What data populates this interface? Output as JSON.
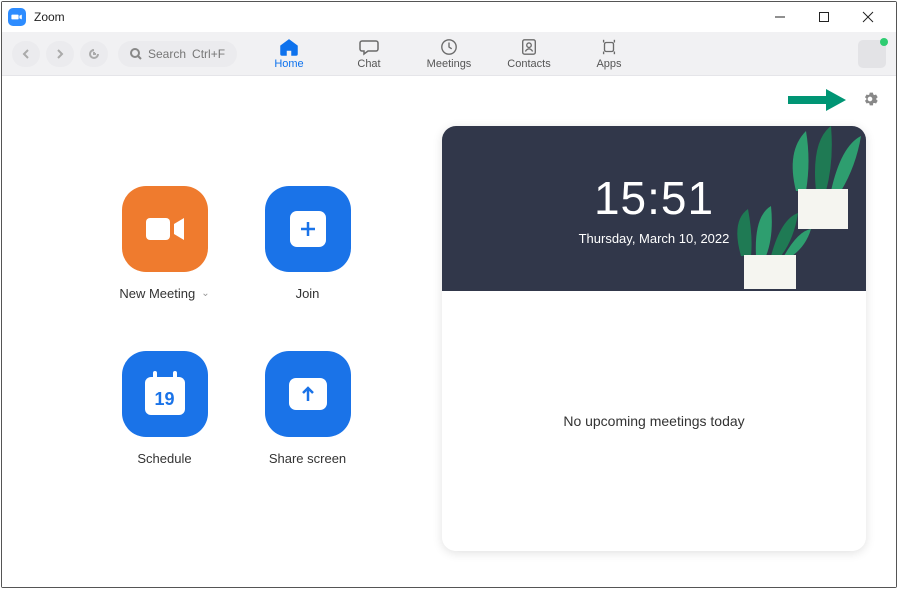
{
  "titlebar": {
    "app_name": "Zoom"
  },
  "toolbar": {
    "search_label": "Search",
    "search_shortcut": "Ctrl+F",
    "tabs": {
      "home": "Home",
      "chat": "Chat",
      "meetings": "Meetings",
      "contacts": "Contacts",
      "apps": "Apps"
    }
  },
  "tiles": {
    "new_meeting": "New Meeting",
    "join": "Join",
    "schedule": "Schedule",
    "schedule_day": "19",
    "share_screen": "Share screen"
  },
  "clock": {
    "time": "15:51",
    "date": "Thursday, March 10, 2022"
  },
  "meetings": {
    "empty_msg": "No upcoming meetings today"
  }
}
